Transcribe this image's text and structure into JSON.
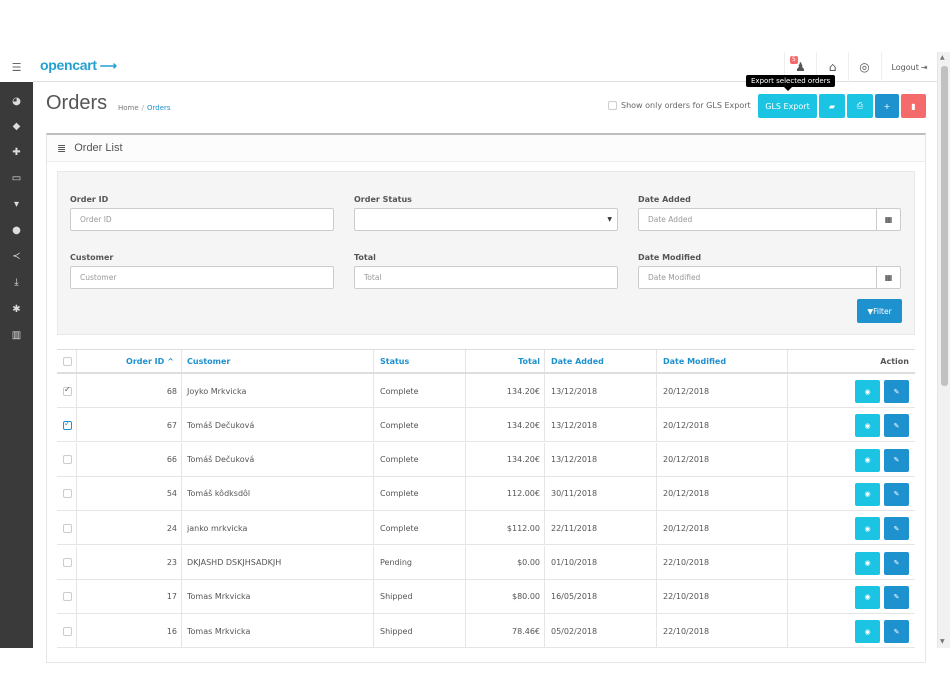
{
  "header": {
    "logo_text": "opencart",
    "notification_count": "5",
    "logout_label": "Logout"
  },
  "page": {
    "title": "Orders",
    "breadcrumb": [
      "Home",
      "Orders"
    ],
    "gls_only_label": "Show only orders for GLS Export",
    "tooltip": "Export selected orders",
    "gls_export_label": "GLS Export"
  },
  "panel": {
    "heading": "Order List"
  },
  "filter": {
    "order_id": {
      "label": "Order ID",
      "placeholder": "Order ID"
    },
    "order_status": {
      "label": "Order Status",
      "value": ""
    },
    "date_added": {
      "label": "Date Added",
      "placeholder": "Date Added"
    },
    "customer": {
      "label": "Customer",
      "placeholder": "Customer"
    },
    "total": {
      "label": "Total",
      "placeholder": "Total"
    },
    "date_modified": {
      "label": "Date Modified",
      "placeholder": "Date Modified"
    },
    "button_label": "Filter"
  },
  "table": {
    "headers": {
      "order_id": "Order ID",
      "customer": "Customer",
      "status": "Status",
      "total": "Total",
      "date_added": "Date Added",
      "date_modified": "Date Modified",
      "action": "Action"
    },
    "rows": [
      {
        "order_id": "68",
        "customer": "Joyko Mrkvicka",
        "status": "Complete",
        "total": "134.20€",
        "date_added": "13/12/2018",
        "date_modified": "20/12/2018",
        "check": "gray"
      },
      {
        "order_id": "67",
        "customer": "Tomáš Dečuková",
        "status": "Complete",
        "total": "134.20€",
        "date_added": "13/12/2018",
        "date_modified": "20/12/2018",
        "check": "blue"
      },
      {
        "order_id": "66",
        "customer": "Tomáš Dečuková",
        "status": "Complete",
        "total": "134.20€",
        "date_added": "13/12/2018",
        "date_modified": "20/12/2018",
        "check": "none"
      },
      {
        "order_id": "54",
        "customer": "Tomáš kôdksdôl",
        "status": "Complete",
        "total": "112.00€",
        "date_added": "30/11/2018",
        "date_modified": "20/12/2018",
        "check": "none"
      },
      {
        "order_id": "24",
        "customer": "janko mrkvicka",
        "status": "Complete",
        "total": "$112.00",
        "date_added": "22/11/2018",
        "date_modified": "20/12/2018",
        "check": "none"
      },
      {
        "order_id": "23",
        "customer": "DKJASHD DSKJHSADKJH",
        "status": "Pending",
        "total": "$0.00",
        "date_added": "01/10/2018",
        "date_modified": "22/10/2018",
        "check": "none"
      },
      {
        "order_id": "17",
        "customer": "Tomas Mrkvicka",
        "status": "Shipped",
        "total": "$80.00",
        "date_added": "16/05/2018",
        "date_modified": "22/10/2018",
        "check": "none"
      },
      {
        "order_id": "16",
        "customer": "Tomas Mrkvicka",
        "status": "Shipped",
        "total": "78.46€",
        "date_added": "05/02/2018",
        "date_modified": "22/10/2018",
        "check": "none"
      }
    ]
  },
  "colors": {
    "info": "#1bc4e3",
    "primary": "#1e91cf",
    "danger": "#f56b6b",
    "sidebar": "#3a3a3a"
  }
}
